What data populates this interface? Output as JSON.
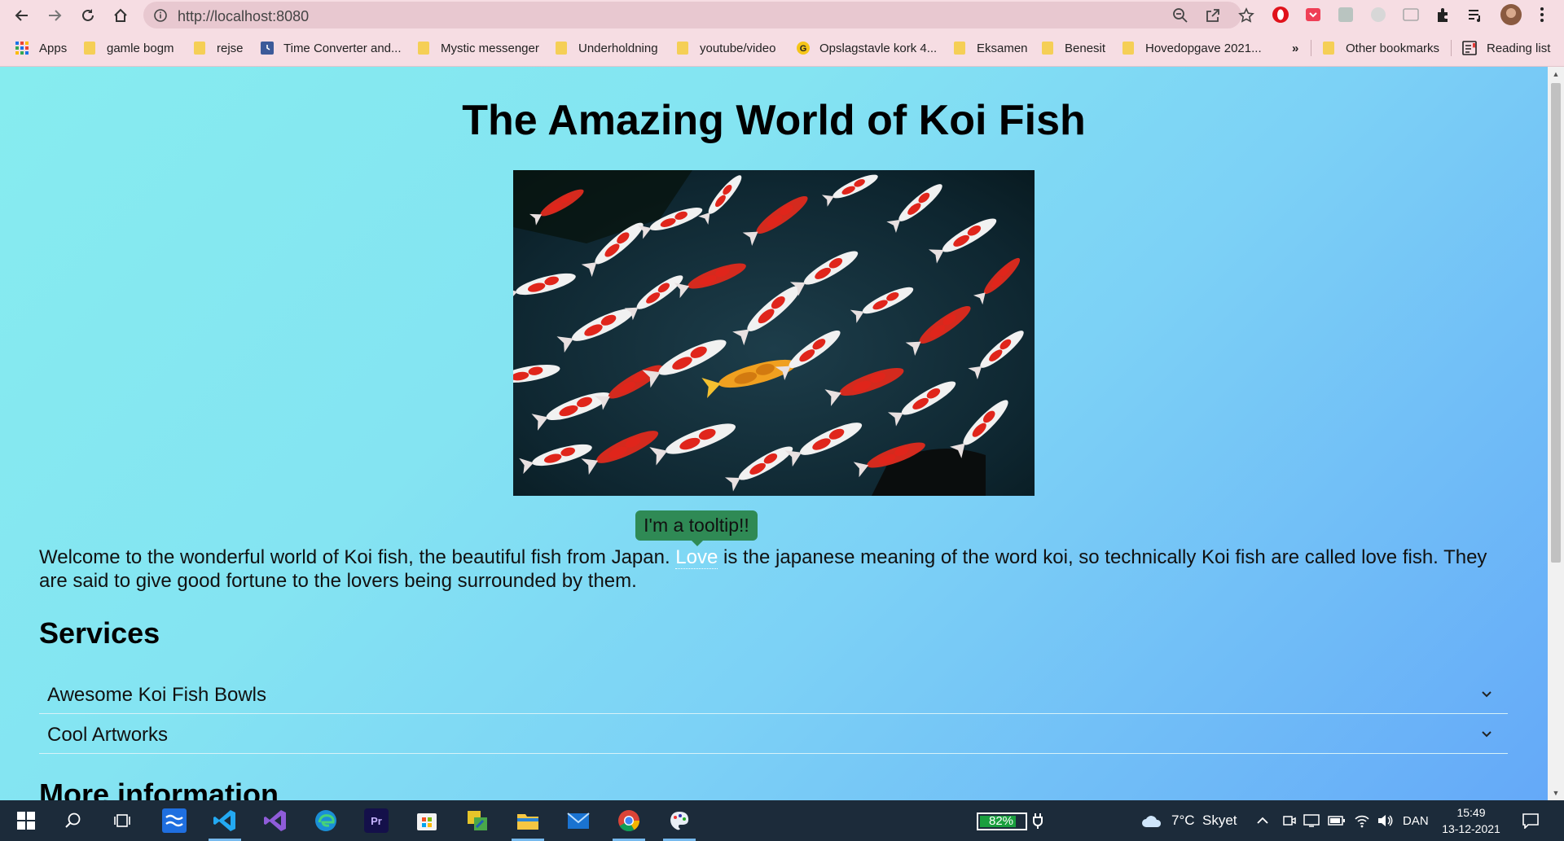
{
  "browser": {
    "url": "http://localhost:8080"
  },
  "bookmarks": {
    "items": [
      {
        "label": "Apps",
        "icon": "apps-grid-icon"
      },
      {
        "label": "gamle bogm",
        "icon": "folder-icon"
      },
      {
        "label": "rejse",
        "icon": "folder-icon"
      },
      {
        "label": "Time Converter and...",
        "icon": "clock-site-icon"
      },
      {
        "label": "Mystic messenger",
        "icon": "folder-icon"
      },
      {
        "label": "Underholdning",
        "icon": "folder-icon"
      },
      {
        "label": "youtube/video",
        "icon": "folder-icon"
      },
      {
        "label": "Opslagstavle kork 4...",
        "icon": "google-icon"
      },
      {
        "label": "Eksamen",
        "icon": "folder-icon"
      },
      {
        "label": "Benesit",
        "icon": "folder-icon"
      },
      {
        "label": "Hovedopgave 2021...",
        "icon": "folder-icon"
      }
    ],
    "overflow": "»",
    "other": "Other bookmarks",
    "reading_list": "Reading list"
  },
  "page": {
    "title": "The Amazing World of Koi Fish",
    "intro_before": "Welcome to the wonderful world of Koi fish, the beautiful fish from Japan. ",
    "intro_link": "Love",
    "intro_after": " is the japanese meaning of the word koi, so technically Koi fish are called love fish. They are said to give good fortune to the lovers being surrounded by them.",
    "tooltip": "I'm a tooltip!!",
    "services_heading": "Services",
    "accordion": [
      {
        "label": "Awesome Koi Fish Bowls"
      },
      {
        "label": "Cool Artworks"
      }
    ],
    "more_heading": "More information"
  },
  "taskbar": {
    "battery_percent": "82%",
    "battery_level": 0.82,
    "weather": "7°C  Skyet",
    "language": "DAN",
    "time": "15:49",
    "date": "13-12-2021"
  }
}
